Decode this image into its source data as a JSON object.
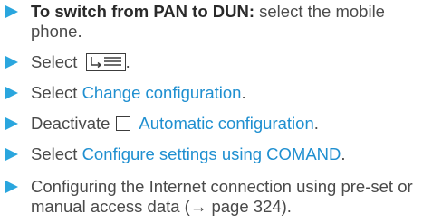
{
  "colors": {
    "bullet": "#2aa6de",
    "highlight": "#1f8fd0",
    "body_text": "#4a4a4a"
  },
  "icons": {
    "bullet": "triangle-right-icon",
    "menu": "menu-list-icon",
    "checkbox": "checkbox-unchecked-icon"
  },
  "steps": [
    {
      "bold": "To switch from PAN to DUN:",
      "text": " select the mobile phone."
    },
    {
      "prefix": "Select ",
      "suffix": "."
    },
    {
      "prefix": "Select ",
      "highlight": "Change configuration",
      "suffix": "."
    },
    {
      "prefix": "Deactivate",
      "highlight": "Automatic configuration",
      "suffix": "."
    },
    {
      "prefix": "Select ",
      "highlight": "Configure settings using COMAND",
      "suffix": "."
    },
    {
      "text": "Configuring the Internet connection using pre-set or manual access data (→ page 324)."
    }
  ]
}
